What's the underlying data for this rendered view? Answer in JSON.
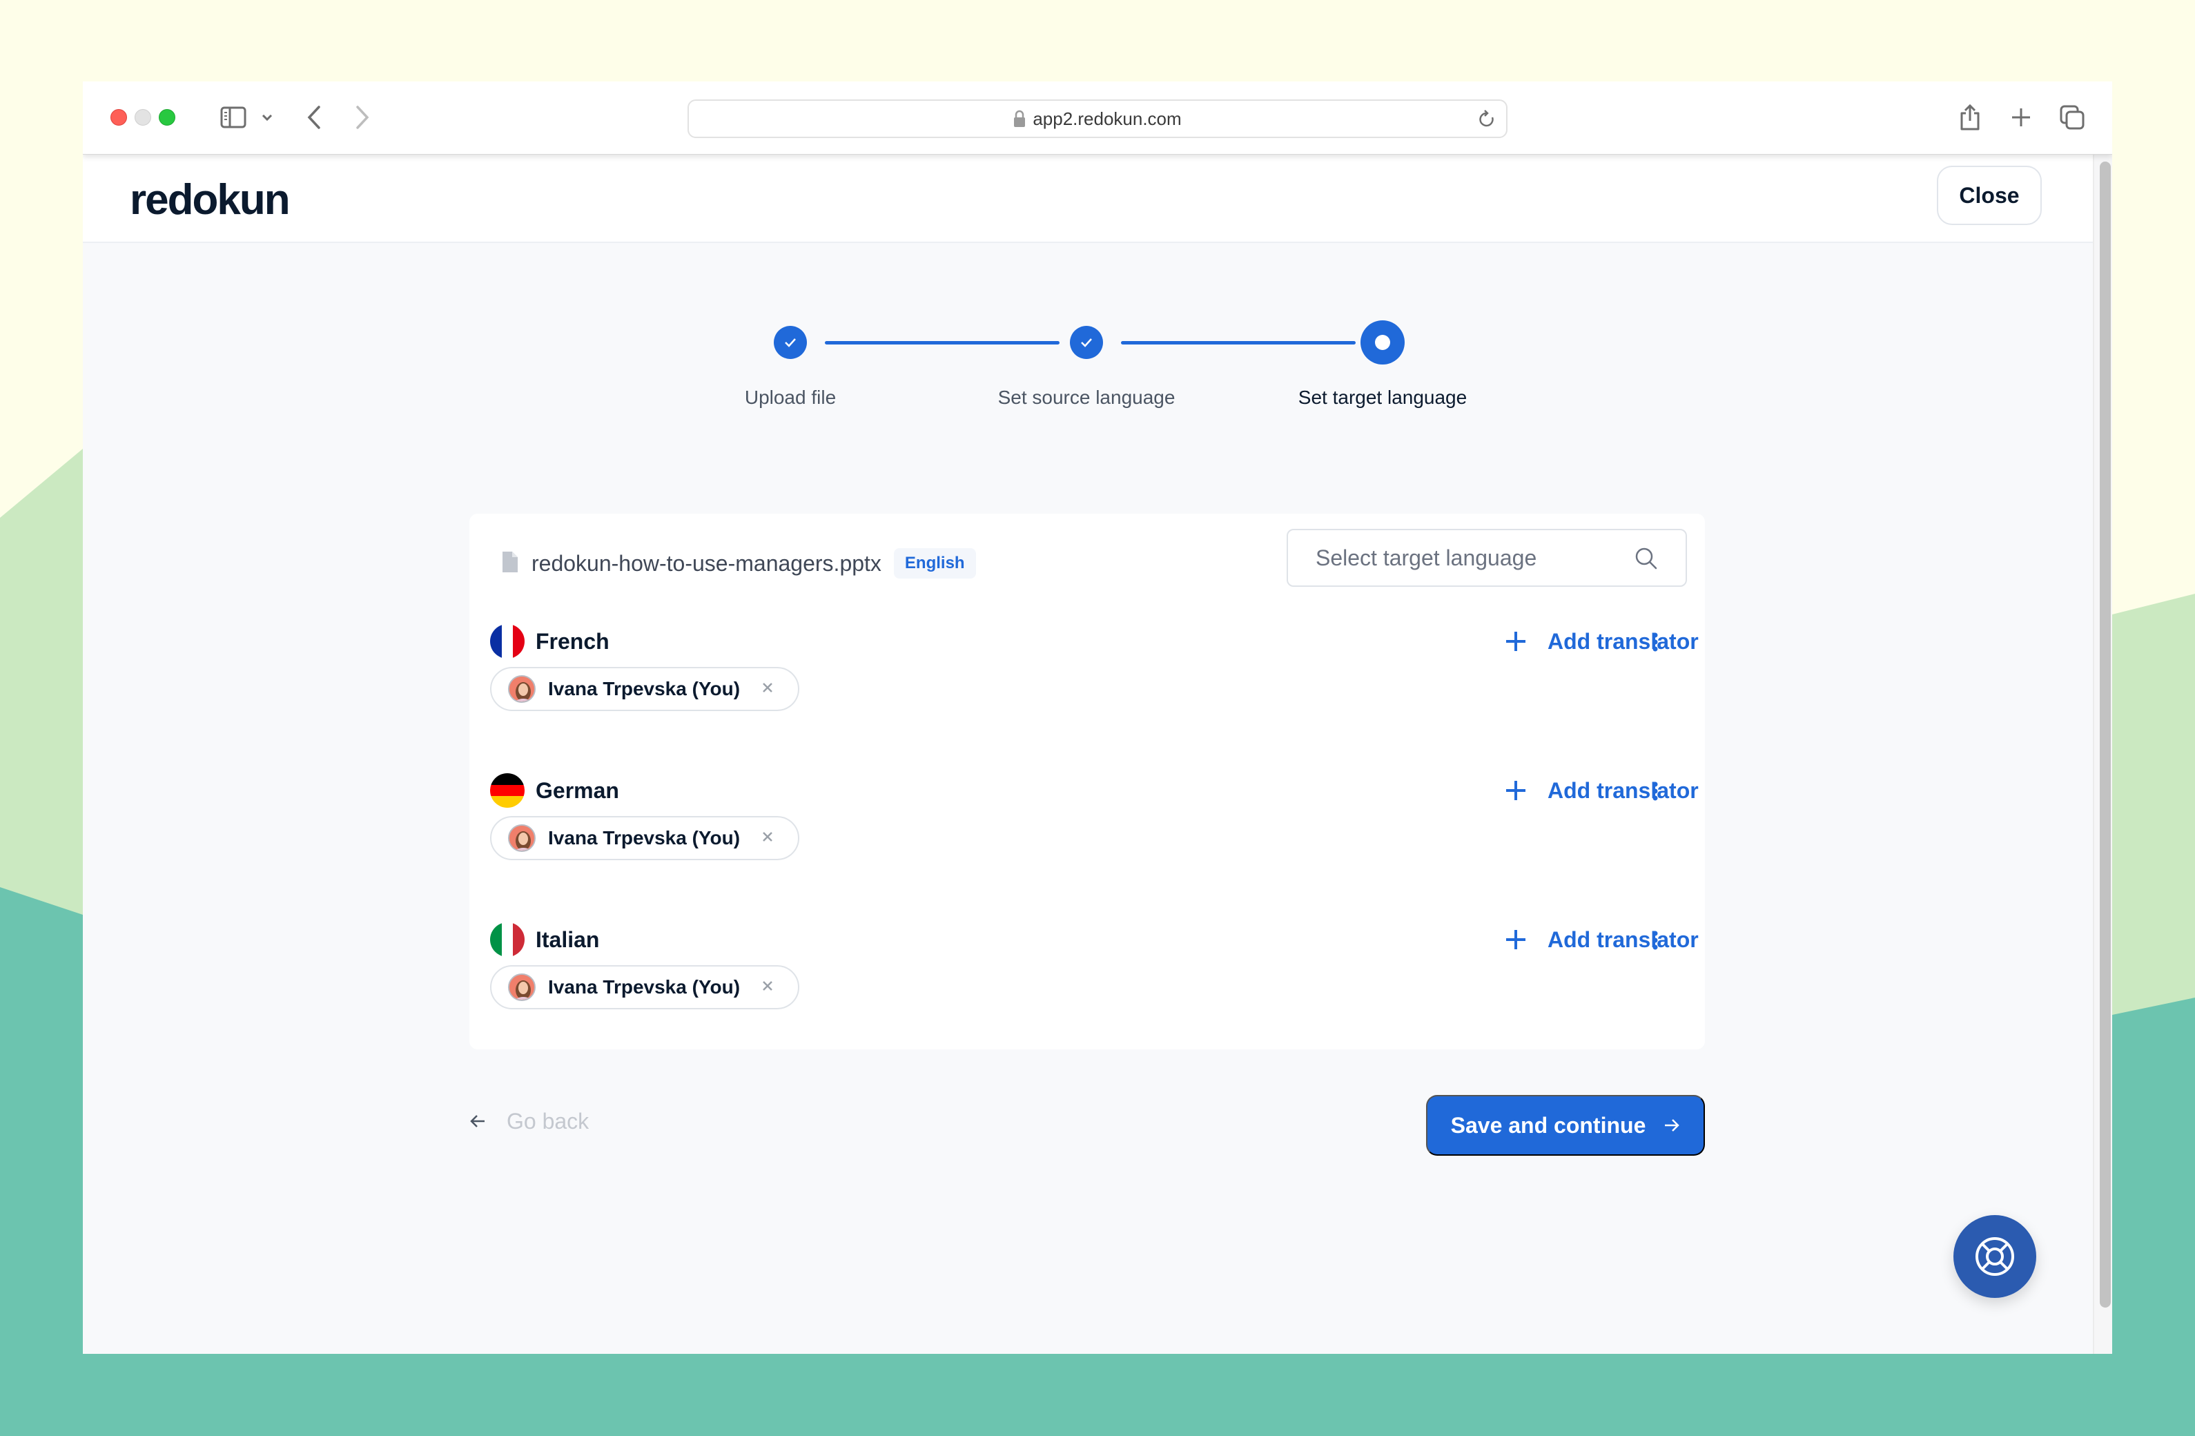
{
  "browser": {
    "url": "app2.redokun.com",
    "icons": [
      "sidebar-icon",
      "chevron-down-icon",
      "back-icon",
      "forward-icon",
      "lock-icon",
      "reload-icon",
      "share-icon",
      "new-tab-icon",
      "tabs-overview-icon"
    ]
  },
  "header": {
    "logo": "redokun",
    "close_label": "Close"
  },
  "stepper": {
    "steps": [
      {
        "label": "Upload file",
        "status": "complete"
      },
      {
        "label": "Set source language",
        "status": "complete"
      },
      {
        "label": "Set target language",
        "status": "current"
      }
    ]
  },
  "file": {
    "name": "redokun-how-to-use-managers.pptx",
    "source_language": "English"
  },
  "search": {
    "placeholder": "Select target language",
    "value": ""
  },
  "languages": [
    {
      "name": "French",
      "flag": "fr",
      "add_label": "Add translator",
      "translators": [
        {
          "name": "Ivana Trpevska (You)"
        }
      ]
    },
    {
      "name": "German",
      "flag": "de",
      "add_label": "Add translator",
      "translators": [
        {
          "name": "Ivana Trpevska (You)"
        }
      ]
    },
    {
      "name": "Italian",
      "flag": "it",
      "add_label": "Add translator",
      "translators": [
        {
          "name": "Ivana Trpevska (You)"
        }
      ]
    }
  ],
  "actions": {
    "go_back": "Go back",
    "save": "Save and continue"
  },
  "colors": {
    "accent": "#2069d9",
    "help_button": "#2b5bb0",
    "text_dark": "#0b1a2e"
  }
}
